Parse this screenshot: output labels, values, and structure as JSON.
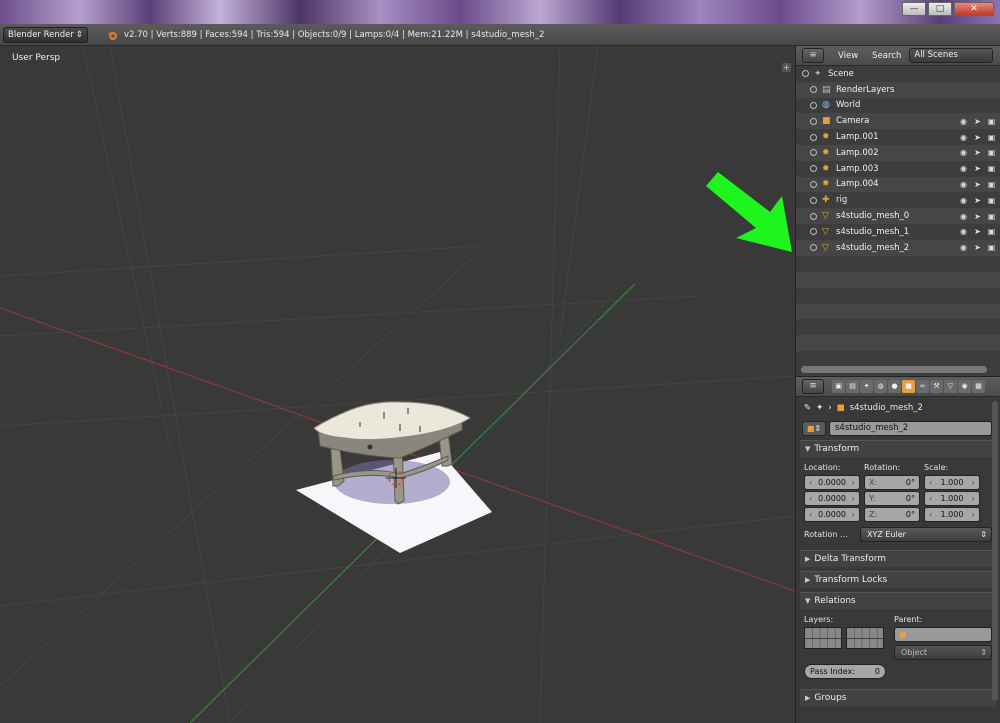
{
  "window": {
    "minimize": "—",
    "maximize": "□",
    "close": "✕"
  },
  "infobar": {
    "engine": "Blender Render",
    "stats": "v2.70 | Verts:889 | Faces:594 | Tris:594 | Objects:0/9 | Lamps:0/4 | Mem:21.22M | s4studio_mesh_2"
  },
  "viewport": {
    "label": "User Persp"
  },
  "outliner": {
    "tabs": [
      "View",
      "Search"
    ],
    "scene_filter": "All Scenes",
    "rows": [
      {
        "label": "Scene",
        "icon": "scene-icon",
        "indent": 0
      },
      {
        "label": "RenderLayers",
        "icon": "renderlayers-icon",
        "indent": 1
      },
      {
        "label": "World",
        "icon": "world-icon",
        "indent": 1
      },
      {
        "label": "Camera",
        "icon": "camera-icon",
        "indent": 1
      },
      {
        "label": "Lamp.001",
        "icon": "lamp-icon",
        "indent": 1
      },
      {
        "label": "Lamp.002",
        "icon": "lamp-icon",
        "indent": 1
      },
      {
        "label": "Lamp.003",
        "icon": "lamp-icon",
        "indent": 1
      },
      {
        "label": "Lamp.004",
        "icon": "lamp-icon",
        "indent": 1
      },
      {
        "label": "rig",
        "icon": "armature-icon",
        "indent": 1
      },
      {
        "label": "s4studio_mesh_0",
        "icon": "mesh-icon",
        "indent": 1
      },
      {
        "label": "s4studio_mesh_1",
        "icon": "mesh-icon",
        "indent": 1
      },
      {
        "label": "s4studio_mesh_2",
        "icon": "mesh-icon",
        "indent": 1
      }
    ]
  },
  "properties": {
    "breadcrumb": "s4studio_mesh_2",
    "object_name": "s4studio_mesh_2",
    "transform": {
      "title": "Transform",
      "location_label": "Location:",
      "rotation_label": "Rotation:",
      "scale_label": "Scale:",
      "location": [
        "0.0000",
        "0.0000",
        "0.0000"
      ],
      "rotation": [
        {
          "axis": "X:",
          "value": "0°"
        },
        {
          "axis": "Y:",
          "value": "0°"
        },
        {
          "axis": "Z:",
          "value": "0°"
        }
      ],
      "scale": [
        "1.000",
        "1.000",
        "1.000"
      ],
      "rotation_mode_label": "Rotation ...",
      "rotation_mode": "XYZ Euler"
    },
    "delta_transform": "Delta Transform",
    "transform_locks": "Transform Locks",
    "relations": {
      "title": "Relations",
      "layers_label": "Layers:",
      "parent_label": "Parent:",
      "parent_type": "Object",
      "pass_index_label": "Pass Index:",
      "pass_index": "0"
    },
    "groups": "Groups"
  },
  "colors": {
    "accent": "#e3a03b",
    "arrow": "#22ff22",
    "x_axis": "#b33a3a",
    "y_axis": "#3a9a3a"
  }
}
